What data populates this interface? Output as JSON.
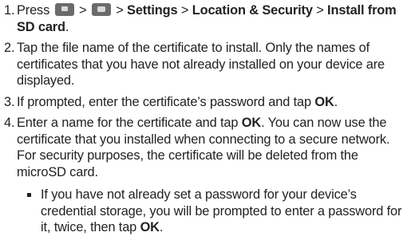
{
  "steps": [
    {
      "number": "1.",
      "parts": {
        "press": "Press",
        "sep1": ">",
        "sep2": ">",
        "settings": "Settings",
        "sep3": ">",
        "location_security": "Location & Security",
        "sep4": ">",
        "install_sd": "Install from SD card",
        "end": "."
      },
      "icons": [
        "menu-key-icon",
        "home-key-icon"
      ]
    },
    {
      "number": "2.",
      "text": "Tap the file name of the certificate to install. Only the names of certificates that you have not already installed on your device are displayed."
    },
    {
      "number": "3.",
      "text": "If prompted, enter the certificate’s password and tap",
      "bold": "OK",
      "end": "."
    },
    {
      "number": "4.",
      "text_before": "Enter a name for the certificate and tap",
      "bold": "OK",
      "text_after": ". You can now use the certificate that you installed when connecting to a secure network. For security purposes, the certificate will be deleted from the microSD card.",
      "sub_bullet": {
        "text": "If you have not already set a password for your device’s credential storage, you will be prompted to enter a password for it, twice, then tap",
        "bold": "OK",
        "end": "."
      }
    }
  ],
  "colors": {
    "text": "#222222",
    "key_icon": "#6b6b6b"
  }
}
